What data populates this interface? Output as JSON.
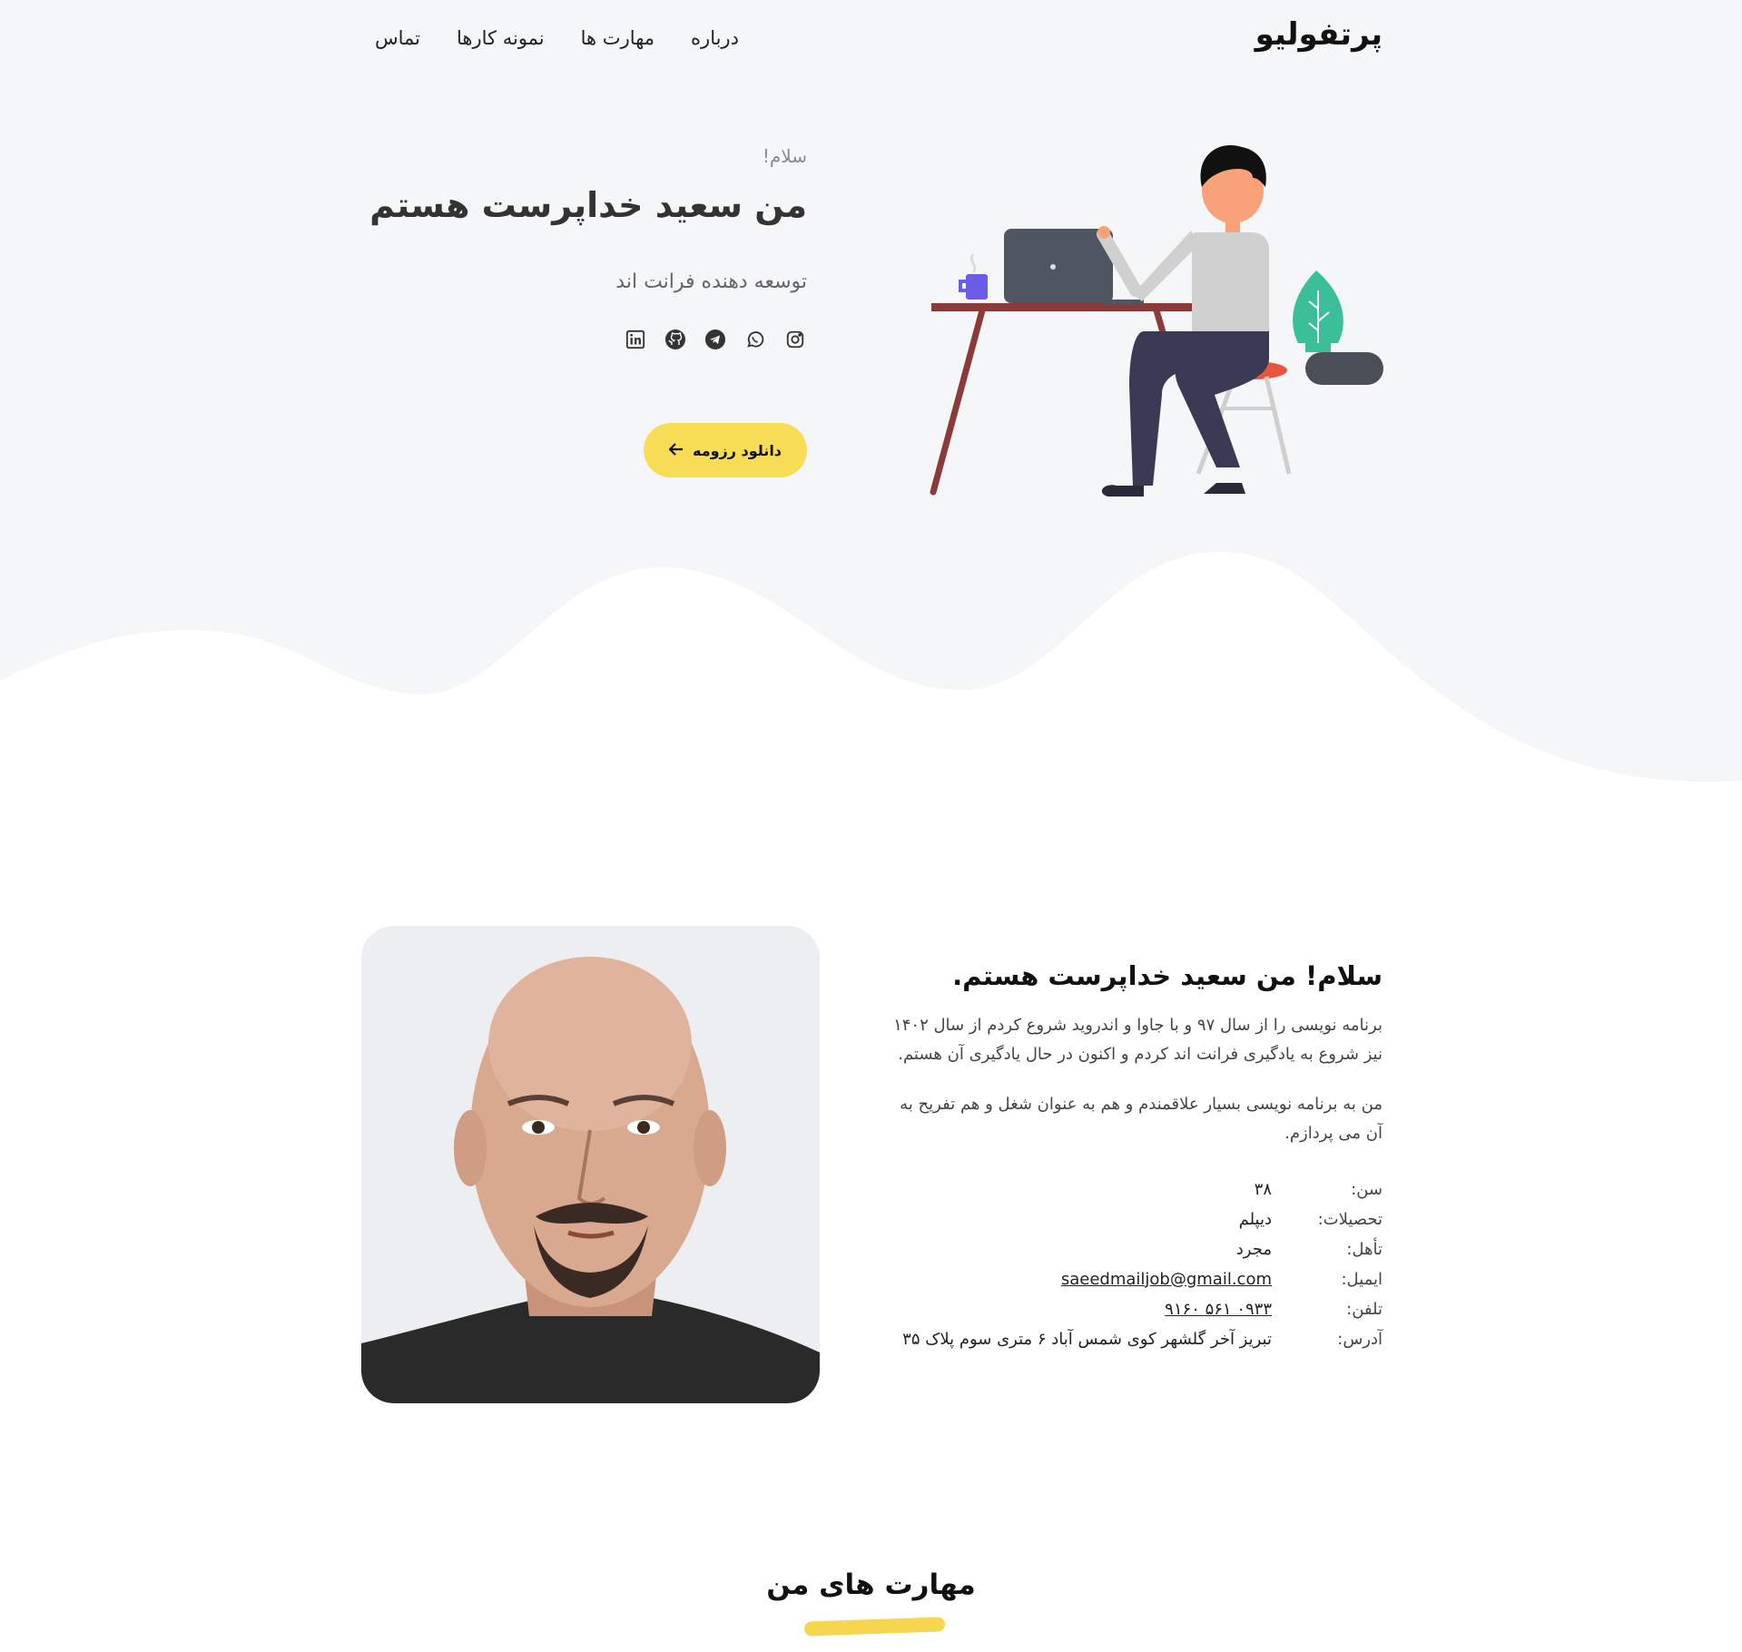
{
  "header": {
    "brand": "پرتفولیو",
    "nav": [
      "درباره",
      "مهارت ها",
      "نمونه کارها",
      "تماس"
    ]
  },
  "hero": {
    "greeting": "سلام!",
    "title_prefix": "من سعید",
    "title_highlight": "خداپرست",
    "title_suffix": "هستم",
    "subtitle": "توسعه دهنده فرانت اند",
    "resume_button": "دانلود رزومه",
    "social_icons": [
      "instagram-icon",
      "whatsapp-icon",
      "telegram-icon",
      "github-icon",
      "linkedin-icon"
    ],
    "colors": {
      "accent": "#f7dd55",
      "background": "#f5f6f8"
    }
  },
  "about": {
    "heading": "سلام! من سعید خداپرست هستم.",
    "paragraph1": "برنامه نویسی را از سال ۹۷ و با جاوا و اندروید شروع کردم از سال ۱۴۰۲ نیز شروع به یادگیری فرانت اند کردم و اکنون در حال یادگیری آن هستم.",
    "paragraph2": "من به برنامه نویسی بسیار علاقمندم و هم به عنوان شغل و هم تفریح به آن می پردازم.",
    "info": {
      "age_label": "سن:",
      "age": "۳۸",
      "education_label": "تحصیلات:",
      "education": "دیپلم",
      "marital_label": "تأهل:",
      "marital": "مجرد",
      "email_label": "ایمیل:",
      "email": "saeedmailjob@gmail.com",
      "phone_label": "تلفن:",
      "phone": "۰۹۳۳ ۵۶۱ ۹۱۶۰",
      "address_label": "آدرس:",
      "address": "تبریز آخر گلشهر کوی شمس آباد ۶ متری سوم پلاک ۳۵"
    }
  },
  "skills": {
    "title": "مهارت های من"
  }
}
